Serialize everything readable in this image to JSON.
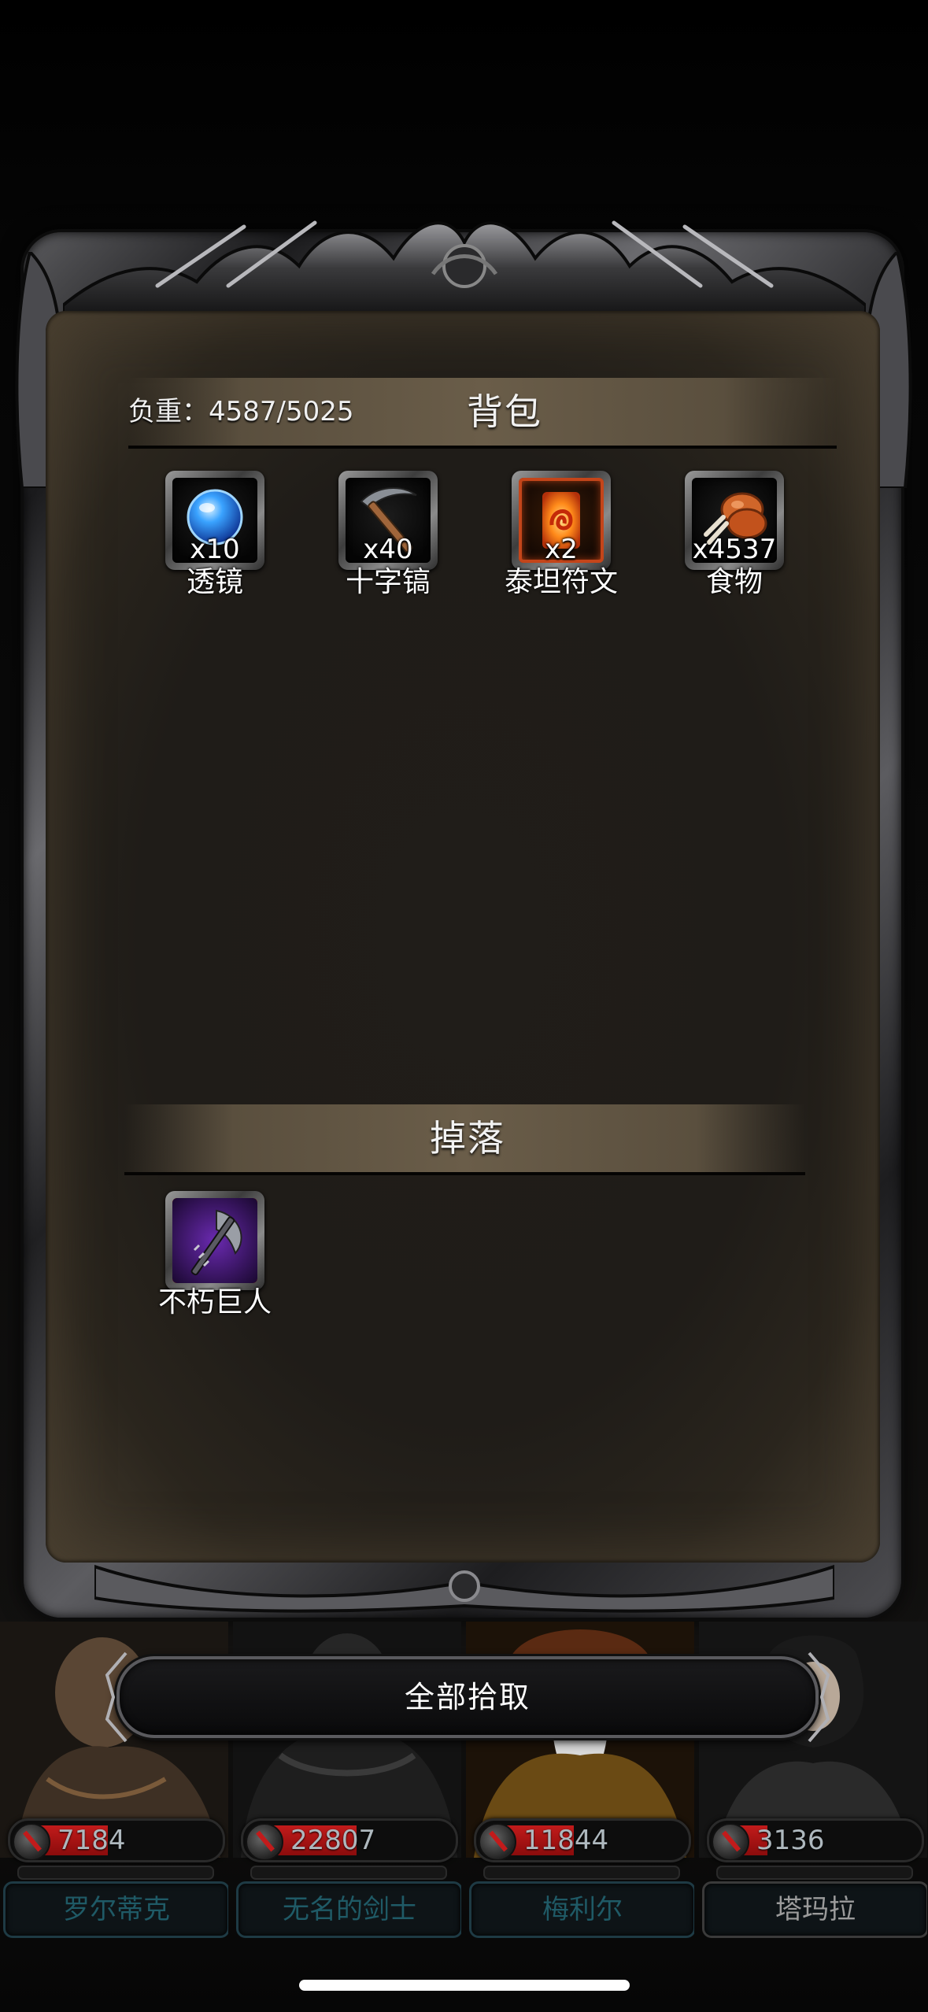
{
  "inventory": {
    "weight_label": "负重：4587/5025",
    "title": "背包",
    "items": [
      {
        "name": "透镜",
        "qty": "x10",
        "icon": "lens-icon"
      },
      {
        "name": "十字镐",
        "qty": "x40",
        "icon": "pickaxe-icon"
      },
      {
        "name": "泰坦符文",
        "qty": "x2",
        "icon": "titan-rune-icon"
      },
      {
        "name": "食物",
        "qty": "x4537",
        "icon": "food-icon"
      }
    ]
  },
  "drops": {
    "title": "掉落",
    "items": [
      {
        "name": "不朽巨人",
        "icon": "purple-axe-icon"
      }
    ]
  },
  "loot_all_button": "全部拾取",
  "party": [
    {
      "name": "罗尔蒂克",
      "hp": "7184",
      "hp_fraction": 0.45
    },
    {
      "name": "无名的剑士",
      "hp": "22807",
      "hp_fraction": 0.55
    },
    {
      "name": "梅利尔",
      "hp": "11844",
      "hp_fraction": 0.45
    },
    {
      "name": "塔玛拉",
      "hp": "3136",
      "hp_fraction": 0.2
    }
  ],
  "colors": {
    "hp_fill": "#c21b1b",
    "rune_border": "#c4451a",
    "panel_bg": "#1f1c18"
  }
}
